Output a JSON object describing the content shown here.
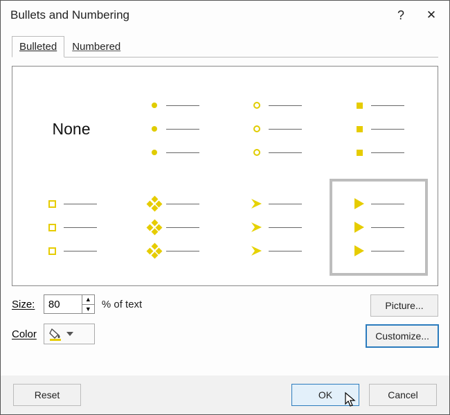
{
  "dialog": {
    "title": "Bullets and Numbering",
    "help": "?",
    "close": "✕"
  },
  "tabs": {
    "bulleted": "Bulleted",
    "numbered": "Numbered"
  },
  "grid": {
    "none_label": "None"
  },
  "controls": {
    "size_label": "Size:",
    "size_value": "80",
    "pct_text": "% of text",
    "color_label": "Color",
    "picture_label": "Picture...",
    "customize_label": "Customize..."
  },
  "footer": {
    "reset": "Reset",
    "ok": "OK",
    "cancel": "Cancel"
  },
  "styles": {
    "accent": "#e6cc00"
  }
}
